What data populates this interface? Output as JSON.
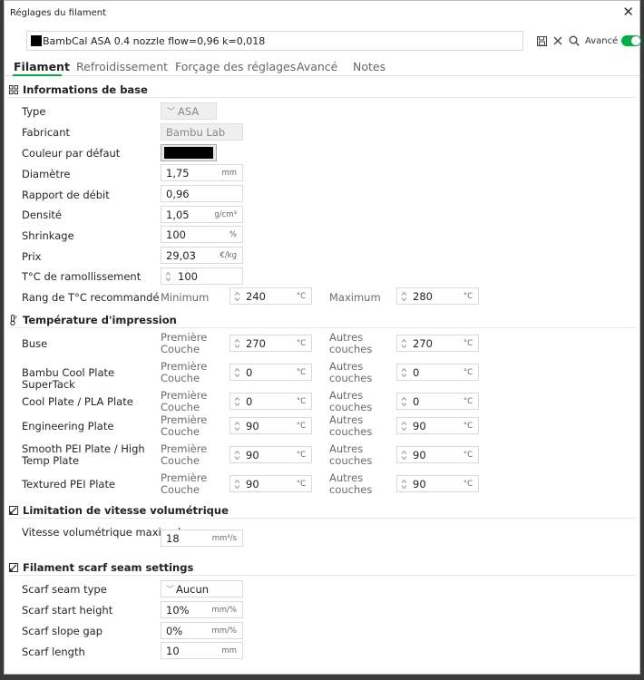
{
  "window": {
    "title": "Réglages du filament",
    "close_icon": "close-icon"
  },
  "preset": {
    "name": "BambCal ASA 0.4 nozzle flow=0,96 k=0,018",
    "color": "#000000"
  },
  "toolbar": {
    "advanced_label": "Avancé",
    "advanced_on": true
  },
  "tabs": [
    "Filament",
    "Refroidissement",
    "Forçage des réglages",
    "Avancé",
    "Notes"
  ],
  "sections": {
    "basic": "Informations de base",
    "temp": "Température d'impression",
    "volumetric": "Limitation de vitesse volumétrique",
    "scarf": "Filament scarf seam settings"
  },
  "basic": {
    "type": {
      "label": "Type",
      "value": "ASA"
    },
    "vendor": {
      "label": "Fabricant",
      "value": "Bambu Lab"
    },
    "color": {
      "label": "Couleur par défaut",
      "value": "#000000"
    },
    "diameter": {
      "label": "Diamètre",
      "value": "1,75",
      "unit": "mm"
    },
    "flow": {
      "label": "Rapport de débit",
      "value": "0,96"
    },
    "density": {
      "label": "Densité",
      "value": "1,05",
      "unit": "g/cm³"
    },
    "shrinkage": {
      "label": "Shrinkage",
      "value": "100",
      "unit": "%"
    },
    "price": {
      "label": "Prix",
      "value": "29,03",
      "unit": "€/kg"
    },
    "softening": {
      "label": "T°C de ramollissement",
      "value": "100"
    },
    "range": {
      "label": "Rang de T°C recommandé",
      "min_label": "Minimum",
      "min": "240",
      "max_label": "Maximum",
      "max": "280",
      "unit": "°C"
    }
  },
  "temp": {
    "first_label": "Première Couche",
    "other_label": "Autres couches",
    "unit": "°C",
    "rows": [
      {
        "label": "Buse",
        "first": "270",
        "other": "270"
      },
      {
        "label": "Bambu Cool Plate SuperTack",
        "first": "0",
        "other": "0"
      },
      {
        "label": "Cool Plate / PLA Plate",
        "first": "0",
        "other": "0"
      },
      {
        "label": "Engineering Plate",
        "first": "90",
        "other": "90"
      },
      {
        "label": "Smooth PEI Plate / High Temp Plate",
        "first": "90",
        "other": "90"
      },
      {
        "label": "Textured PEI Plate",
        "first": "90",
        "other": "90"
      }
    ]
  },
  "volumetric": {
    "label": "Vitesse volumétrique maximale",
    "value": "18",
    "unit": "mm³/s"
  },
  "scarf": {
    "seam_type": {
      "label": "Scarf seam type",
      "value": "Aucun"
    },
    "start_height": {
      "label": "Scarf start height",
      "value": "10%",
      "unit": "mm/%"
    },
    "slope_gap": {
      "label": "Scarf slope gap",
      "value": "0%",
      "unit": "mm/%"
    },
    "length": {
      "label": "Scarf length",
      "value": "10",
      "unit": "mm"
    }
  }
}
